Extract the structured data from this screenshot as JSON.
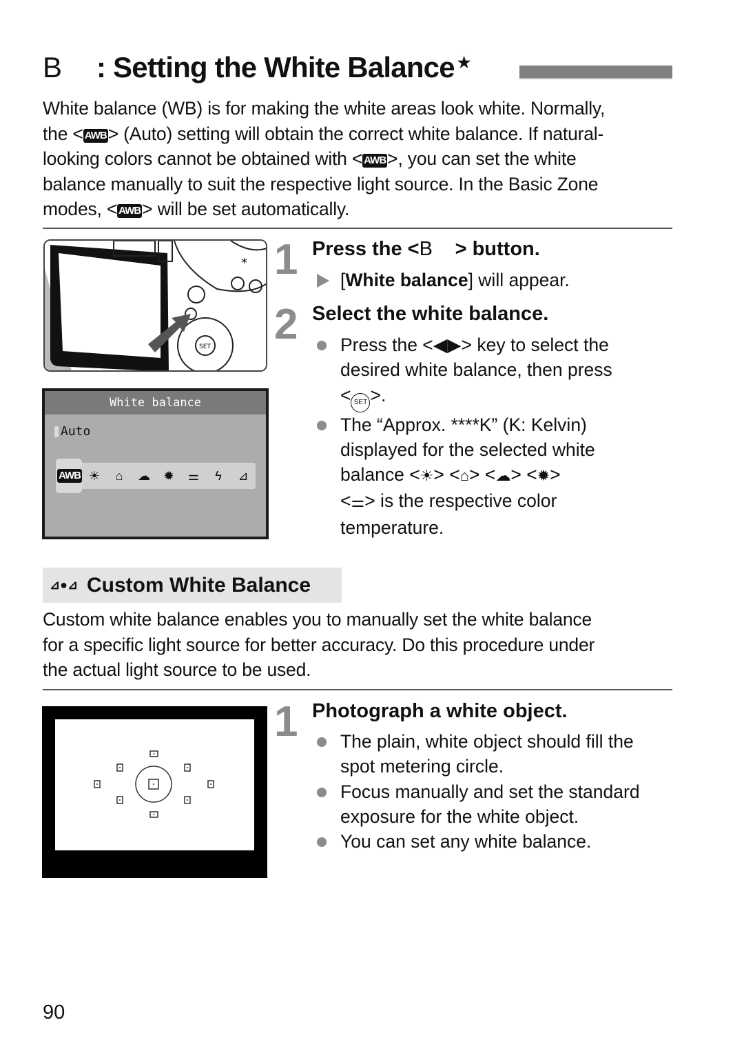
{
  "page": {
    "title_glyph": "B",
    "title": ": Setting the White Balance",
    "title_star": "★",
    "page_number": "90"
  },
  "intro": {
    "line1": "White balance (WB) is for making the white areas look white. Normally,",
    "line2_a": "the <",
    "line2_b": "> (Auto) setting will obtain the correct white balance. If natural-",
    "line3_a": "looking colors cannot be obtained with <",
    "line3_b": ">, you can set the white",
    "line4": "balance manually to suit the respective light source. In the Basic Zone",
    "line5_a": "modes, <",
    "line5_b": "> will be set automatically.",
    "awb_label": "AWB"
  },
  "lcd_menu": {
    "header": "White balance",
    "current": "Auto",
    "icons": [
      "AWB",
      "☀",
      "⌂",
      "☁",
      "✹",
      "⚌",
      "ϟ",
      "⊿"
    ],
    "icon_names": [
      "awb-icon",
      "daylight-icon",
      "shade-icon",
      "cloudy-icon",
      "tungsten-icon",
      "fluorescent-icon",
      "flash-icon",
      "custom-wb-icon"
    ],
    "selected_index": 0
  },
  "steps_a": [
    {
      "number": "1",
      "heading_a": "Press the <",
      "heading_glyph": "B",
      "heading_b": "> button.",
      "result_bold": "White balance",
      "result_rest": "] will appear.",
      "result_open": "["
    },
    {
      "number": "2",
      "heading": "Select the white balance.",
      "bullet1_a": "Press the <",
      "bullet1_keys": "◀▶",
      "bullet1_b": "> key to select the",
      "bullet1_c": "desired white balance, then press",
      "bullet1_d_a": "<",
      "bullet1_set": "SET",
      "bullet1_d_b": ">.",
      "bullet2_line1": "The “Approx. ****K” (K: Kelvin)",
      "bullet2_line2": "displayed for the selected white",
      "bullet2_line3_a": "balance <",
      "bullet2_sep": "> <",
      "bullet2_line3_end": ">",
      "bullet2_line4_b": "> is the respective color",
      "bullet2_line5": "temperature.",
      "wb_icons": [
        "☀",
        "⌂",
        "☁",
        "✹",
        "⚌"
      ]
    }
  ],
  "custom": {
    "heading": "Custom White Balance",
    "heading_icon": "⊿●⊿",
    "line1": "Custom white balance enables you to manually set the white balance",
    "line2": "for a specific light source for better accuracy. Do this procedure under",
    "line3": "the actual light source to be used."
  },
  "steps_b": [
    {
      "number": "1",
      "heading": "Photograph a white object.",
      "bullets": [
        [
          "The plain, white object should fill the",
          "spot metering circle."
        ],
        [
          "Focus manually and set the standard",
          "exposure for the white object."
        ],
        [
          "You can set any white balance."
        ]
      ]
    }
  ]
}
